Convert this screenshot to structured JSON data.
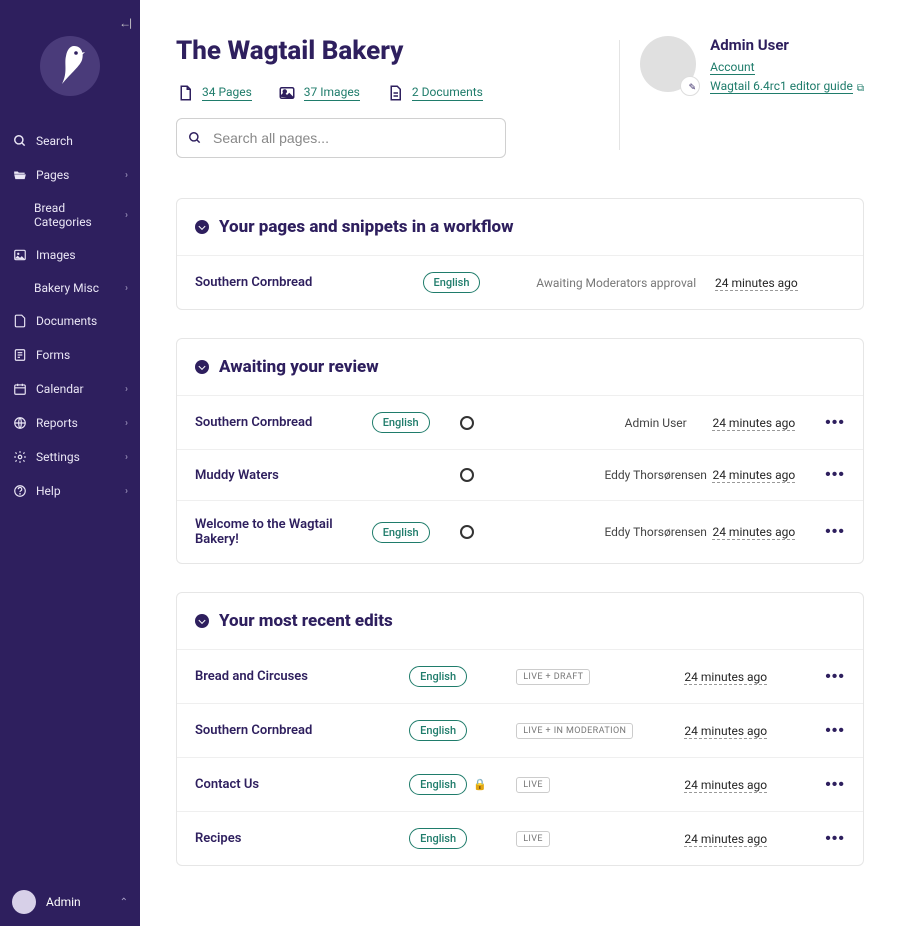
{
  "sidebar": {
    "search": "Search",
    "items": [
      {
        "label": "Pages",
        "sub": "Bread Categories"
      },
      {
        "label": "Images",
        "sub": "Bakery Misc"
      },
      {
        "label": "Documents"
      },
      {
        "label": "Forms"
      },
      {
        "label": "Calendar"
      },
      {
        "label": "Reports"
      },
      {
        "label": "Settings"
      },
      {
        "label": "Help"
      }
    ],
    "footer_user": "Admin"
  },
  "site_title": "The Wagtail Bakery",
  "summary": {
    "pages": "34 Pages",
    "images": "37 Images",
    "documents": "2 Documents"
  },
  "search_placeholder": "Search all pages...",
  "user": {
    "name": "Admin User",
    "account": "Account",
    "guide": "Wagtail 6.4rc1 editor guide"
  },
  "panels": {
    "workflow": {
      "title": "Your pages and snippets in a workflow",
      "rows": [
        {
          "name": "Southern Cornbread",
          "lang": "English",
          "status": "Awaiting Moderators approval",
          "time": "24 minutes ago"
        }
      ]
    },
    "review": {
      "title": "Awaiting your review",
      "rows": [
        {
          "name": "Southern Cornbread",
          "lang": "English",
          "user": "Admin User",
          "time": "24 minutes ago"
        },
        {
          "name": "Muddy Waters",
          "lang": "",
          "user": "Eddy Thorsørensen",
          "time": "24 minutes ago"
        },
        {
          "name": "Welcome to the Wagtail Bakery!",
          "lang": "English",
          "user": "Eddy Thorsørensen",
          "time": "24 minutes ago"
        }
      ]
    },
    "edits": {
      "title": "Your most recent edits",
      "rows": [
        {
          "name": "Bread and Circuses",
          "lang": "English",
          "status": "LIVE + DRAFT",
          "time": "24 minutes ago",
          "locked": false
        },
        {
          "name": "Southern Cornbread",
          "lang": "English",
          "status": "LIVE + IN MODERATION",
          "time": "24 minutes ago",
          "locked": false
        },
        {
          "name": "Contact Us",
          "lang": "English",
          "status": "LIVE",
          "time": "24 minutes ago",
          "locked": true
        },
        {
          "name": "Recipes",
          "lang": "English",
          "status": "LIVE",
          "time": "24 minutes ago",
          "locked": false
        }
      ]
    }
  }
}
